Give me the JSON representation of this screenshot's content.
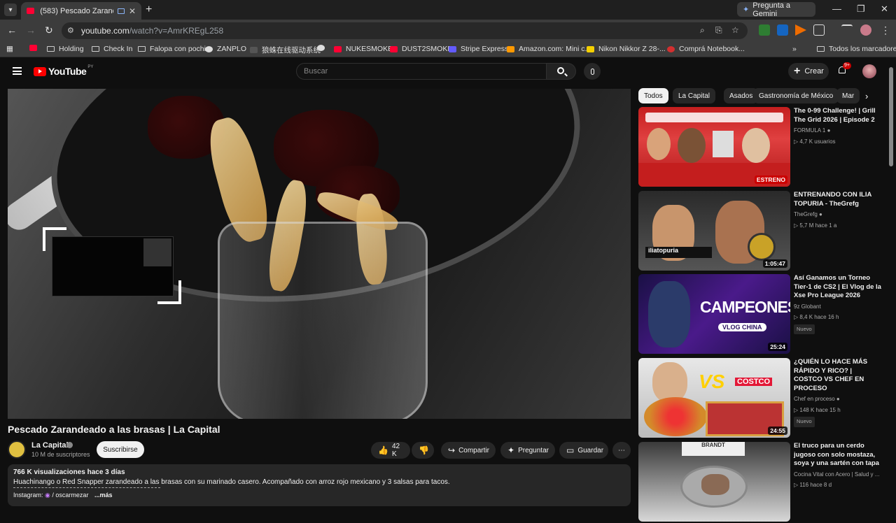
{
  "browser": {
    "tab_title": "(583) Pescado Zarandeado a",
    "new_tab": "+",
    "gemini_label": "Pregunta a Gemini",
    "url_host": "youtube.com",
    "url_path": "/watch?v=AmrKREgL258",
    "bookmarks": [
      "Holding",
      "Check In",
      "Falopa con pochi",
      "ZANPLO",
      "狼蛛在线驱动系统",
      "NUKESMOKE",
      "DUST2SMOKE",
      "Stripe Express",
      "Amazon.com: Mini c...",
      "Nikon Nikkor Z 28-...",
      "Comprá Notebook..."
    ],
    "all_bookmarks": "Todos los marcadores",
    "more_bookmarks": "»"
  },
  "yt": {
    "wordmark": "YouTube",
    "region": "PY",
    "search_placeholder": "Buscar",
    "create_label": "Crear",
    "notif_count": "9+"
  },
  "video": {
    "title": "Pescado Zarandeado a las brasas | La Capital",
    "channel": "La Capital",
    "subscribers": "10 M de suscriptores",
    "subscribe_label": "Suscribirse",
    "likes": "42 K",
    "share_label": "Compartir",
    "ask_label": "Preguntar",
    "save_label": "Guardar",
    "views_date": "766 K visualizaciones  hace 3 días",
    "description": "Huachinango o Red Snapper zarandeado a las brasas con su marinado casero. Acompañado con arroz rojo mexicano y 3 salsas para tacos.",
    "instagram": "Instagram:",
    "instagram_handle": "/ oscarmezar",
    "more": "...más"
  },
  "chips": [
    "Todos",
    "La Capital",
    "Asados",
    "Gastronomía de México",
    "Mar"
  ],
  "recommendations": [
    {
      "title": "The 0-99 Challenge! | Grill The Grid 2026 | Episode 2",
      "channel": "FORMULA 1",
      "meta": "4,7 K usuarios",
      "duration": "ESTRENO",
      "badge": ""
    },
    {
      "title": "ENTRENANDO CON ILIA TOPURIA - TheGrefg",
      "channel": "TheGrefg",
      "meta": "5,7 M  hace 1 a",
      "duration": "1:05:47",
      "badge": ""
    },
    {
      "title": "Así Ganamos un Torneo Tier-1 de CS2 | El Vlog de la Xse Pro League 2026",
      "channel": "9z Globant",
      "meta": "8,4 K  hace 16 h",
      "duration": "25:24",
      "badge": "Nuevo"
    },
    {
      "title": "¿QUIÉN LO HACE MÁS RÁPIDO Y RICO? | COSTCO VS CHEF EN PROCESO",
      "channel": "Chef en proceso",
      "meta": "148 K  hace 15 h",
      "duration": "24:55",
      "badge": "Nuevo"
    },
    {
      "title": "El truco para un cerdo jugoso con solo mostaza, soya y una sartén con tapa",
      "channel": "Cocina Vital con Acero | Salud y ...",
      "meta": "116  hace 8 d",
      "duration": "",
      "badge": ""
    }
  ],
  "thumb_text": {
    "r1": "ESTRENO",
    "r2": "iliatopuria",
    "r3a": "CAMPEONES",
    "r3b": "VLOG CHINA",
    "r4a": "VS",
    "r4b": "COSTCO",
    "r5": "BRANDT"
  }
}
